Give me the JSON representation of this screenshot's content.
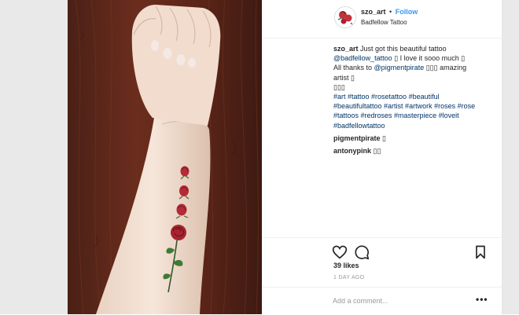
{
  "header": {
    "username": "szo_art",
    "dot": "•",
    "follow_label": "Follow",
    "location": "Badfellow Tattoo"
  },
  "caption": {
    "username": "szo_art",
    "line1_text": "Just got this beautiful tattoo",
    "line2_mention": "@badfellow_tattoo",
    "line2_text": "▯ I love it sooo much ▯",
    "line3_text": "All thanks to",
    "line3_mention": "@pigmentpirate",
    "line3_after": "▯▯▯ amazing",
    "line4_text": "artist ▯",
    "line5_text": "▯▯▯",
    "hashtags_line1": "#art #tattoo #rosetattoo #beautiful",
    "hashtags_line2": "#beautifultattoo #artist #artwork #roses #rose",
    "hashtags_line3": "#tattoos #redroses #masterpiece #loveit",
    "hashtags_line4": "#badfellowtattoo"
  },
  "comments": [
    {
      "username": "pigmentpirate",
      "text": "▯"
    },
    {
      "username": "antonypink",
      "text": "▯▯"
    }
  ],
  "actions": {
    "like_icon": "heart-icon",
    "comment_icon": "speech-bubble-icon",
    "save_icon": "bookmark-icon"
  },
  "likes": "39 likes",
  "timestamp": "1 DAY AGO",
  "add_comment": {
    "placeholder": "Add a comment..."
  },
  "more_label": "•••",
  "colors": {
    "follow_blue": "#3897f0",
    "hashtag_blue": "#003569",
    "rose_red": "#b52a38"
  }
}
